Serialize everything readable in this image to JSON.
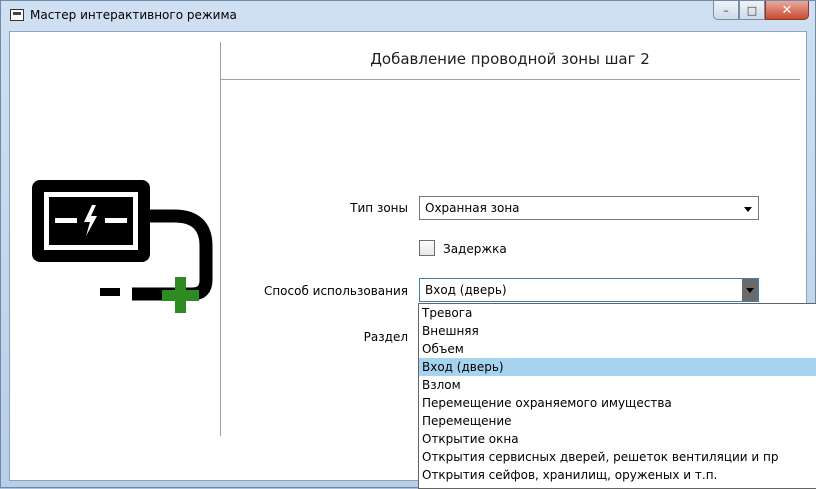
{
  "window": {
    "title": "Мастер интерактивного режима",
    "buttons": {
      "minimize": "–",
      "maximize": "□",
      "close": "✕"
    }
  },
  "step": {
    "title": "Добавление проводной зоны шаг 2"
  },
  "icons": {
    "app": "window-icon",
    "wired_zone": "wired-zone-add-icon",
    "accent_color": "#2e8b22"
  },
  "form": {
    "zone_type": {
      "label": "Тип зоны",
      "value": "Охранная зона"
    },
    "delay": {
      "label": "Задержка",
      "checked": false
    },
    "usage": {
      "label": "Способ использования",
      "value": "Вход (дверь)"
    },
    "section": {
      "label": "Раздел"
    }
  },
  "dropdown": {
    "items": [
      "Тревога",
      "Внешняя",
      "Объем",
      "Вход (дверь)",
      "Взлом",
      "Перемещение охраняемого имущества",
      "Перемещение",
      "Открытие окна",
      "Открытия сервисных дверей, решеток вентиляции и пр",
      "Открытия сейфов, хранилищ, оруженых и т.п."
    ],
    "selected_index": 3,
    "selection_color": "#a6d3ef"
  }
}
